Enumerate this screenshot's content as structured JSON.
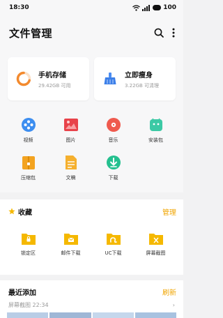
{
  "status_bar": {
    "time": "18:30",
    "battery": "100"
  },
  "header": {
    "title": "文件管理"
  },
  "storage_cards": [
    {
      "title": "手机存储",
      "subtitle": "29.42GB 可用"
    },
    {
      "title": "立即瘦身",
      "subtitle": "3.22GB 可清理"
    }
  ],
  "categories": [
    {
      "label": "视频",
      "icon": "video-icon",
      "color": "#3d8ef0"
    },
    {
      "label": "图片",
      "icon": "image-icon",
      "color": "#e8424a"
    },
    {
      "label": "音乐",
      "icon": "music-icon",
      "color": "#ef5a4e"
    },
    {
      "label": "安装包",
      "icon": "android-icon",
      "color": "#3cc9a5"
    },
    {
      "label": "压缩包",
      "icon": "archive-icon",
      "color": "#f3a320"
    },
    {
      "label": "文稿",
      "icon": "document-icon",
      "color": "#f5b02e"
    },
    {
      "label": "下载",
      "icon": "download-icon",
      "color": "#25c08f"
    }
  ],
  "favorites": {
    "title": "收藏",
    "action": "管理",
    "items": [
      {
        "label": "锁定区",
        "icon": "lock-folder-icon"
      },
      {
        "label": "邮件下载",
        "icon": "mail-folder-icon"
      },
      {
        "label": "UC下载",
        "icon": "uc-folder-icon"
      },
      {
        "label": "屏幕截图",
        "icon": "screenshot-folder-icon"
      }
    ]
  },
  "recent": {
    "title": "最近添加",
    "action": "刷新",
    "group_label": "屏幕截图 22:34",
    "chevron": "›"
  },
  "colors": {
    "accent": "#f0a500",
    "folder": "#f5b800"
  }
}
